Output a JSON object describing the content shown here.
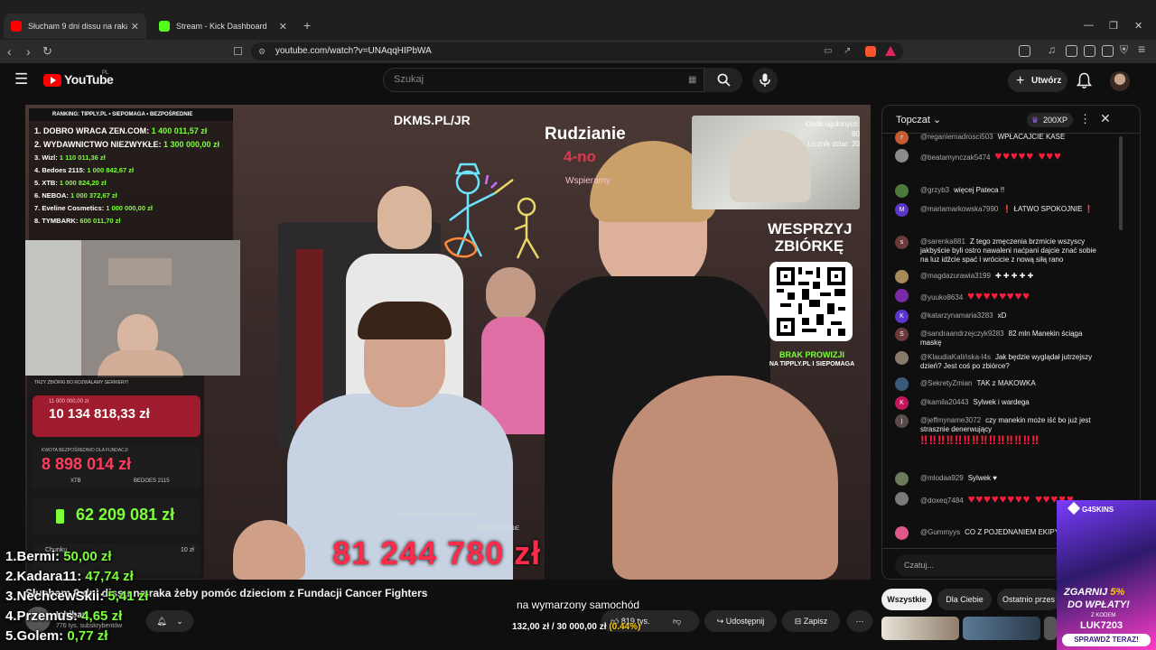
{
  "browser": {
    "tabs": [
      {
        "title": "Słucham 9 dni dissu na raka ż"
      },
      {
        "title": "Stream - Kick Dashboard"
      }
    ],
    "url": "youtube.com/watch?v=UNAqqHIPbWA"
  },
  "youtube": {
    "logo_text": "YouTube",
    "country": "PL",
    "search_placeholder": "Szukaj",
    "create_label": "Utwórz"
  },
  "video": {
    "ranking_header": "RANKING:   TIPPLY.PL • SIEPOMAGA • BEZPOŚREDNIE",
    "ranking": [
      {
        "label": "1. DOBRO WRACA ZEN.COM: ",
        "value": "1 400 011,57 zł"
      },
      {
        "label": "2. WYDAWNICTWO NIEZWYKŁE: ",
        "value": "1 300 000,00 zł"
      },
      {
        "label": "3. Wizl: ",
        "value": "1 110 011,36 zł"
      },
      {
        "label": "4. Bedoes 2115: ",
        "value": "1 000 842,67 zł"
      },
      {
        "label": "5. XTB: ",
        "value": "1 000 824,20 zł"
      },
      {
        "label": "6. NEBOA: ",
        "value": "1 000 372,67 zł"
      },
      {
        "label": "7. Eveline Cosmetics: ",
        "value": "1 000 000,00 zł"
      },
      {
        "label": "8. TYMBARK: ",
        "value": "600 011,70 zł"
      }
    ],
    "dkms": "DKMS.PL/JR",
    "rudzianie": "Rudzianie",
    "rudzianie_sub": "4-no ",
    "wspieramy": "Wspieramy",
    "cam_counter1": "Osób ogolonych: 80",
    "cam_counter2": "Licznik dziar: 20",
    "wesprzyj_line1": "WESPRZYJ",
    "wesprzyj_line2": "ZBIÓRKĘ",
    "brak_prowizji": "BRAK PROWIZJI",
    "na_tipply": "NA TIPPLY.PL I SIEPOMAGA",
    "trzy_zbiorki": "TRZY ZBIÓRKI BO ROZWALAMY SERWERY!",
    "goal_small": "11 000 000,00 zł",
    "total1": "10 134 818,33 zł",
    "kwota_label": "KWOTA BEZPOŚREDNIO DLA FUNDACJI",
    "total2": "8 898 014 zł",
    "xtb_small": "XTB",
    "bedoes_small": "BEDOES 2115",
    "total3": "62 209 081 zł",
    "suma_label": "SUMA WSZYSTKICH ZBIÓREK",
    "bezposrednie": "BEZPOŚREDNIE",
    "big_total": "81 244 780 zł",
    "small_10zl": "10 zł",
    "chunk_label": "Chunku"
  },
  "overlay": {
    "top5": [
      {
        "label": "1.Bermi: ",
        "value": "50,00 zł"
      },
      {
        "label": "2.Kadara11: ",
        "value": "47,74 zł"
      },
      {
        "label": "3.NechcewSkii: ",
        "value": "5,41 zł"
      },
      {
        "label": "4.Przemus: ",
        "value": "4,65 zł"
      },
      {
        "label": "5.Golem: ",
        "value": "0,77 zł"
      }
    ],
    "goal_title": "na wymarzony samochód",
    "goal_current": "132,00 zł",
    "goal_sep": " / ",
    "goal_target": "30 000,00 zł",
    "goal_percent": "(0.44%)"
  },
  "watch": {
    "title": "Słucham 9 dni dissu na raka żeby pomóc dzieciom z Fundacji Cancer Fighters",
    "channel": "Ichiban",
    "subscribers": "776 tys. subskrybentów",
    "likes": "819 tys.",
    "share_label": "Udostępnij",
    "save_label": "Zapisz"
  },
  "chat": {
    "mode": "Topczat",
    "points": "200XP",
    "input_placeholder": "Czatuj...",
    "messages": [
      {
        "user": "@reganiemadrosci503",
        "text": "WPŁACAJCIE KASE",
        "avatar": "r",
        "color": "#c75b32"
      },
      {
        "user": "@beatamynczak5474",
        "text": "",
        "hearts": "♥♥♥♥♥ ♥♥♥",
        "avatar": "",
        "color": "#8b8b8b"
      },
      {
        "user": "@grzyb3",
        "text": "więcej Pateca !!",
        "avatar": "",
        "color": "#4d7a3a"
      },
      {
        "user": "@mariamarkowska7990",
        "text": "❗ ŁATWO SPOKOJNIE ❗",
        "avatar": "M",
        "color": "#5c35cc"
      },
      {
        "user": "@sarenka881",
        "text": "Z tego zmęczenia brzmicie wszyscy jakbyście byli ostro nawaleni naćpani dajcie znać sobie na luz idźcie spać i wrócicie z nową siłą rano",
        "avatar": "s",
        "color": "#6b3a3a"
      },
      {
        "user": "@magdazurawia3199",
        "text": "✚ ✚ ✚ ✚ ✚",
        "avatar": "",
        "color": "#a88a5a"
      },
      {
        "user": "@yuuko8634",
        "text": "",
        "hearts": "♥♥♥♥♥♥♥♥",
        "avatar": "",
        "color": "#7a2aa8"
      },
      {
        "user": "@katarzynamaria3283",
        "text": "xD",
        "avatar": "K",
        "color": "#5c35cc"
      },
      {
        "user": "@sandraandrzejczyk9283",
        "text": "82 mln Manekin ściąga maskę",
        "avatar": "S",
        "color": "#6b3a3a"
      },
      {
        "user": "@KlaudiaKalińska-l4s",
        "text": "Jak będzie wyglądał jutrzejszy dzień? Jest coś po zbiórce?",
        "avatar": "",
        "color": "#8a7a6a"
      },
      {
        "user": "@SekretyZmian",
        "text": "TAK z MAKOWKA",
        "avatar": "",
        "color": "#3a5a7a"
      },
      {
        "user": "@kamila20443",
        "text": "Sylwek i wardega",
        "avatar": "K",
        "color": "#c2185b"
      },
      {
        "user": "@jeffmyname3072",
        "text": "czy manekin może iść bo już jest strasznie denerwujący",
        "bangs": "‼‼‼‼‼‼‼‼‼‼‼‼‼‼",
        "avatar": "j",
        "color": "#5a4a4a"
      },
      {
        "user": "@mlodaa929",
        "text": "Sylwek ♥",
        "avatar": "",
        "color": "#6a7a5a"
      },
      {
        "user": "@doxeq7484",
        "text": "",
        "hearts": "♥♥♥♥♥♥♥♥ ♥♥♥♥♥",
        "avatar": "",
        "color": "#7a7a7a"
      },
      {
        "user": "@Gummyys",
        "text": "CO Z POJEDNANIEM EKIPY",
        "avatar": "",
        "color": "#e0588a"
      }
    ]
  },
  "chips": [
    "Wszystkie",
    "Dla Ciebie",
    "Ostatnio przes"
  ],
  "ad": {
    "brand": "G4SKINS",
    "line1": "ZGARNIJ",
    "percent": "5%",
    "line2": "DO WPŁATY!",
    "code_label": "Z KODEM",
    "code": "LUK7203",
    "cta": "SPRAWDŹ TERAZ!"
  },
  "colors": {
    "accent": "#ff0000",
    "goal_green": "#7cff3a",
    "goal_percent": "#ffd000",
    "heart": "#ff1b3b"
  }
}
